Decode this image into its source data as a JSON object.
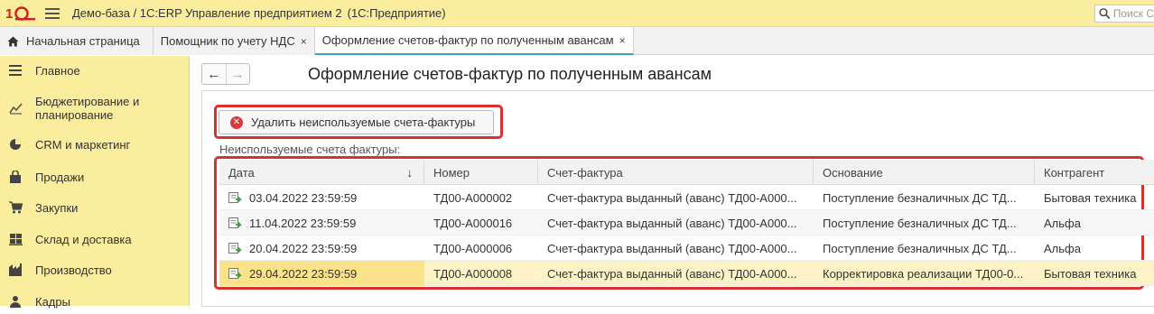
{
  "titlebar": {
    "app_title": "Демо-база / 1С:ERP Управление предприятием 2",
    "app_subtitle": "(1С:Предприятие)",
    "search_placeholder": "Поиск С"
  },
  "tabs": [
    {
      "label": "Начальная страница"
    },
    {
      "label": "Помощник по учету НДС",
      "close": "×"
    },
    {
      "label": "Оформление счетов-фактур по полученным авансам",
      "close": "×"
    }
  ],
  "sidebar": {
    "items": [
      {
        "label": "Главное",
        "icon": "menu-icon"
      },
      {
        "label": "Бюджетирование и планирование",
        "icon": "chart-icon"
      },
      {
        "label": "CRM и маркетинг",
        "icon": "pie-icon"
      },
      {
        "label": "Продажи",
        "icon": "bag-icon"
      },
      {
        "label": "Закупки",
        "icon": "cart-icon"
      },
      {
        "label": "Склад и доставка",
        "icon": "warehouse-icon"
      },
      {
        "label": "Производство",
        "icon": "factory-icon"
      },
      {
        "label": "Кадры",
        "icon": "person-icon"
      }
    ]
  },
  "main": {
    "nav_back": "←",
    "nav_forward": "→",
    "title": "Оформление счетов-фактур по полученным авансам",
    "delete_button": "Удалить неиспользуемые счета-фактуры",
    "list_label": "Неиспользуемые счета фактуры:",
    "sort_arrow": "↓",
    "columns": [
      "Дата",
      "Номер",
      "Счет-фактура",
      "Основание",
      "Контрагент"
    ],
    "rows": [
      {
        "date": "03.04.2022 23:59:59",
        "number": "ТД00-А000002",
        "invoice": "Счет-фактура выданный (аванс) ТД00-А000...",
        "basis": "Поступление безналичных ДС ТД...",
        "counterparty": "Бытовая техника"
      },
      {
        "date": "11.04.2022 23:59:59",
        "number": "ТД00-А000016",
        "invoice": "Счет-фактура выданный (аванс) ТД00-А000...",
        "basis": "Поступление безналичных ДС ТД...",
        "counterparty": "Альфа"
      },
      {
        "date": "20.04.2022 23:59:59",
        "number": "ТД00-А000006",
        "invoice": "Счет-фактура выданный (аванс) ТД00-А000...",
        "basis": "Поступление безналичных ДС ТД...",
        "counterparty": "Альфа"
      },
      {
        "date": "29.04.2022 23:59:59",
        "number": "ТД00-А000008",
        "invoice": "Счет-фактура выданный (аванс) ТД00-А000...",
        "basis": "Корректировка реализации ТД00-0...",
        "counterparty": "Бытовая техника"
      }
    ]
  },
  "colors": {
    "accent_yellow": "#fbed9e",
    "highlight_red": "#d93030",
    "tab_underline": "#3aa0c2",
    "selected_row": "#fdf3c6"
  }
}
